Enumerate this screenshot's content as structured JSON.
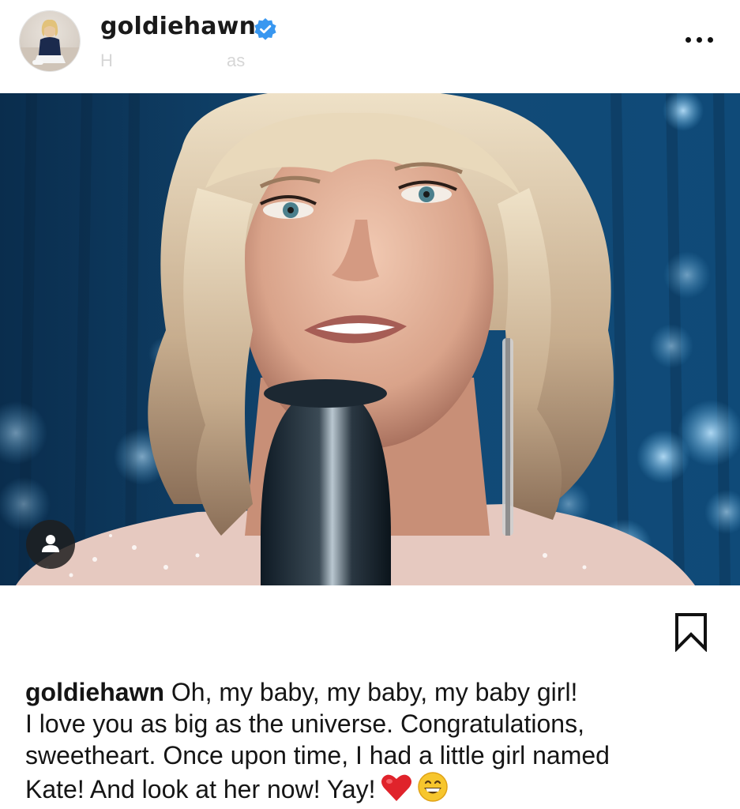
{
  "post": {
    "username": "goldiehawn",
    "verified": true,
    "subtitle_fragments": [
      "H",
      "as"
    ],
    "more_icon": "ellipsis-icon"
  },
  "photo": {
    "subject": "singer-at-microphone",
    "tag_icon": "person-icon"
  },
  "actions": {
    "bookmark_icon": "bookmark-icon"
  },
  "caption": {
    "username": "goldiehawn",
    "line1": " Oh, my baby, my baby, my baby girl!",
    "line2": "I love you as big as the universe. Congratulations,",
    "line3": "sweetheart. Once upon time, I had a little girl named",
    "line4": "Kate! And look at her now! Yay!",
    "emojis": [
      "red-heart",
      "grinning-face-with-smiling-eyes"
    ]
  },
  "colors": {
    "verified_blue": "#3897f0",
    "text": "#151515",
    "heart_red": "#e0232b",
    "emoji_yellow": "#f7c62d"
  }
}
